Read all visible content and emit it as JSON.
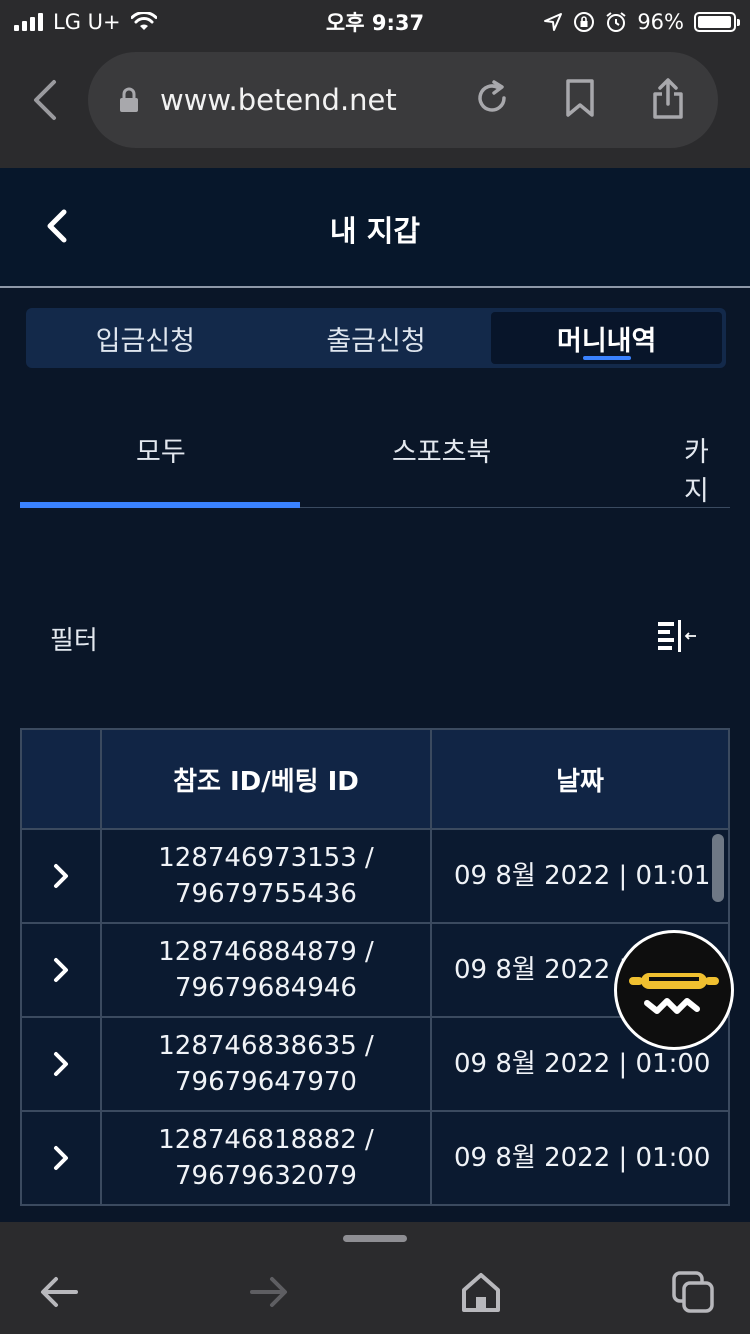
{
  "status_bar": {
    "carrier": "LG U+",
    "time": "오후 9:37",
    "battery": "96%"
  },
  "browser": {
    "url": "www.betend.net"
  },
  "header": {
    "title": "내 지갑"
  },
  "wallet_tabs": [
    {
      "label": "입금신청",
      "active": false
    },
    {
      "label": "출금신청",
      "active": false
    },
    {
      "label": "머니내역",
      "active": true
    }
  ],
  "sub_tabs": [
    {
      "label": "모두",
      "active": true
    },
    {
      "label": "스포츠북",
      "active": false
    },
    {
      "label": "카지",
      "active": false
    }
  ],
  "filter": {
    "label": "필터"
  },
  "table": {
    "headers": [
      "",
      "참조 ID/베팅 ID",
      "날짜"
    ],
    "rows": [
      {
        "ref_id": "128746973153 /",
        "bet_id": "79679755436",
        "date": "09 8월 2022 | 01:01"
      },
      {
        "ref_id": "128746884879 /",
        "bet_id": "79679684946",
        "date": "09 8월 2022 | 01:01"
      },
      {
        "ref_id": "128746838635 /",
        "bet_id": "79679647970",
        "date": "09 8월 2022 | 01:00"
      },
      {
        "ref_id": "128746818882 /",
        "bet_id": "79679632079",
        "date": "09 8월 2022 | 01:00"
      }
    ]
  },
  "colors": {
    "accent": "#3a82ff",
    "background": "#0a1628",
    "header_bg": "#07172b",
    "fab_yellow": "#f0c030"
  }
}
